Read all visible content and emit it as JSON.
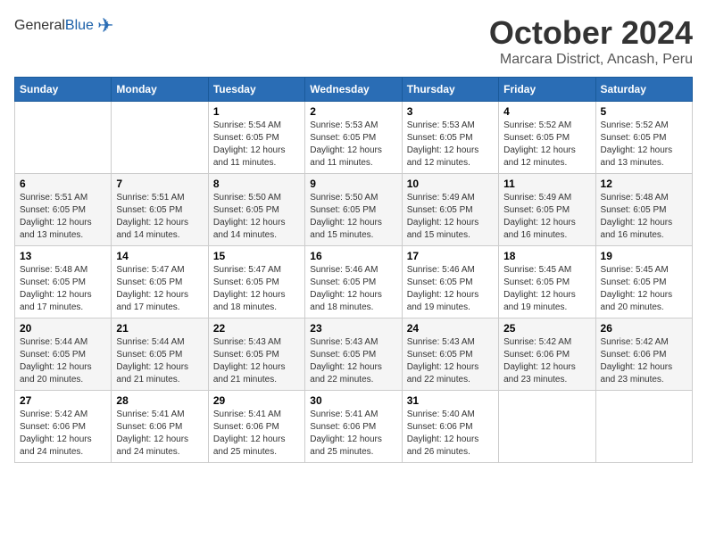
{
  "header": {
    "logo_general": "General",
    "logo_blue": "Blue",
    "title": "October 2024",
    "subtitle": "Marcara District, Ancash, Peru"
  },
  "days_of_week": [
    "Sunday",
    "Monday",
    "Tuesday",
    "Wednesday",
    "Thursday",
    "Friday",
    "Saturday"
  ],
  "weeks": [
    [
      {
        "day": "",
        "detail": ""
      },
      {
        "day": "",
        "detail": ""
      },
      {
        "day": "1",
        "detail": "Sunrise: 5:54 AM\nSunset: 6:05 PM\nDaylight: 12 hours\nand 11 minutes."
      },
      {
        "day": "2",
        "detail": "Sunrise: 5:53 AM\nSunset: 6:05 PM\nDaylight: 12 hours\nand 11 minutes."
      },
      {
        "day": "3",
        "detail": "Sunrise: 5:53 AM\nSunset: 6:05 PM\nDaylight: 12 hours\nand 12 minutes."
      },
      {
        "day": "4",
        "detail": "Sunrise: 5:52 AM\nSunset: 6:05 PM\nDaylight: 12 hours\nand 12 minutes."
      },
      {
        "day": "5",
        "detail": "Sunrise: 5:52 AM\nSunset: 6:05 PM\nDaylight: 12 hours\nand 13 minutes."
      }
    ],
    [
      {
        "day": "6",
        "detail": "Sunrise: 5:51 AM\nSunset: 6:05 PM\nDaylight: 12 hours\nand 13 minutes."
      },
      {
        "day": "7",
        "detail": "Sunrise: 5:51 AM\nSunset: 6:05 PM\nDaylight: 12 hours\nand 14 minutes."
      },
      {
        "day": "8",
        "detail": "Sunrise: 5:50 AM\nSunset: 6:05 PM\nDaylight: 12 hours\nand 14 minutes."
      },
      {
        "day": "9",
        "detail": "Sunrise: 5:50 AM\nSunset: 6:05 PM\nDaylight: 12 hours\nand 15 minutes."
      },
      {
        "day": "10",
        "detail": "Sunrise: 5:49 AM\nSunset: 6:05 PM\nDaylight: 12 hours\nand 15 minutes."
      },
      {
        "day": "11",
        "detail": "Sunrise: 5:49 AM\nSunset: 6:05 PM\nDaylight: 12 hours\nand 16 minutes."
      },
      {
        "day": "12",
        "detail": "Sunrise: 5:48 AM\nSunset: 6:05 PM\nDaylight: 12 hours\nand 16 minutes."
      }
    ],
    [
      {
        "day": "13",
        "detail": "Sunrise: 5:48 AM\nSunset: 6:05 PM\nDaylight: 12 hours\nand 17 minutes."
      },
      {
        "day": "14",
        "detail": "Sunrise: 5:47 AM\nSunset: 6:05 PM\nDaylight: 12 hours\nand 17 minutes."
      },
      {
        "day": "15",
        "detail": "Sunrise: 5:47 AM\nSunset: 6:05 PM\nDaylight: 12 hours\nand 18 minutes."
      },
      {
        "day": "16",
        "detail": "Sunrise: 5:46 AM\nSunset: 6:05 PM\nDaylight: 12 hours\nand 18 minutes."
      },
      {
        "day": "17",
        "detail": "Sunrise: 5:46 AM\nSunset: 6:05 PM\nDaylight: 12 hours\nand 19 minutes."
      },
      {
        "day": "18",
        "detail": "Sunrise: 5:45 AM\nSunset: 6:05 PM\nDaylight: 12 hours\nand 19 minutes."
      },
      {
        "day": "19",
        "detail": "Sunrise: 5:45 AM\nSunset: 6:05 PM\nDaylight: 12 hours\nand 20 minutes."
      }
    ],
    [
      {
        "day": "20",
        "detail": "Sunrise: 5:44 AM\nSunset: 6:05 PM\nDaylight: 12 hours\nand 20 minutes."
      },
      {
        "day": "21",
        "detail": "Sunrise: 5:44 AM\nSunset: 6:05 PM\nDaylight: 12 hours\nand 21 minutes."
      },
      {
        "day": "22",
        "detail": "Sunrise: 5:43 AM\nSunset: 6:05 PM\nDaylight: 12 hours\nand 21 minutes."
      },
      {
        "day": "23",
        "detail": "Sunrise: 5:43 AM\nSunset: 6:05 PM\nDaylight: 12 hours\nand 22 minutes."
      },
      {
        "day": "24",
        "detail": "Sunrise: 5:43 AM\nSunset: 6:05 PM\nDaylight: 12 hours\nand 22 minutes."
      },
      {
        "day": "25",
        "detail": "Sunrise: 5:42 AM\nSunset: 6:06 PM\nDaylight: 12 hours\nand 23 minutes."
      },
      {
        "day": "26",
        "detail": "Sunrise: 5:42 AM\nSunset: 6:06 PM\nDaylight: 12 hours\nand 23 minutes."
      }
    ],
    [
      {
        "day": "27",
        "detail": "Sunrise: 5:42 AM\nSunset: 6:06 PM\nDaylight: 12 hours\nand 24 minutes."
      },
      {
        "day": "28",
        "detail": "Sunrise: 5:41 AM\nSunset: 6:06 PM\nDaylight: 12 hours\nand 24 minutes."
      },
      {
        "day": "29",
        "detail": "Sunrise: 5:41 AM\nSunset: 6:06 PM\nDaylight: 12 hours\nand 25 minutes."
      },
      {
        "day": "30",
        "detail": "Sunrise: 5:41 AM\nSunset: 6:06 PM\nDaylight: 12 hours\nand 25 minutes."
      },
      {
        "day": "31",
        "detail": "Sunrise: 5:40 AM\nSunset: 6:06 PM\nDaylight: 12 hours\nand 26 minutes."
      },
      {
        "day": "",
        "detail": ""
      },
      {
        "day": "",
        "detail": ""
      }
    ]
  ]
}
